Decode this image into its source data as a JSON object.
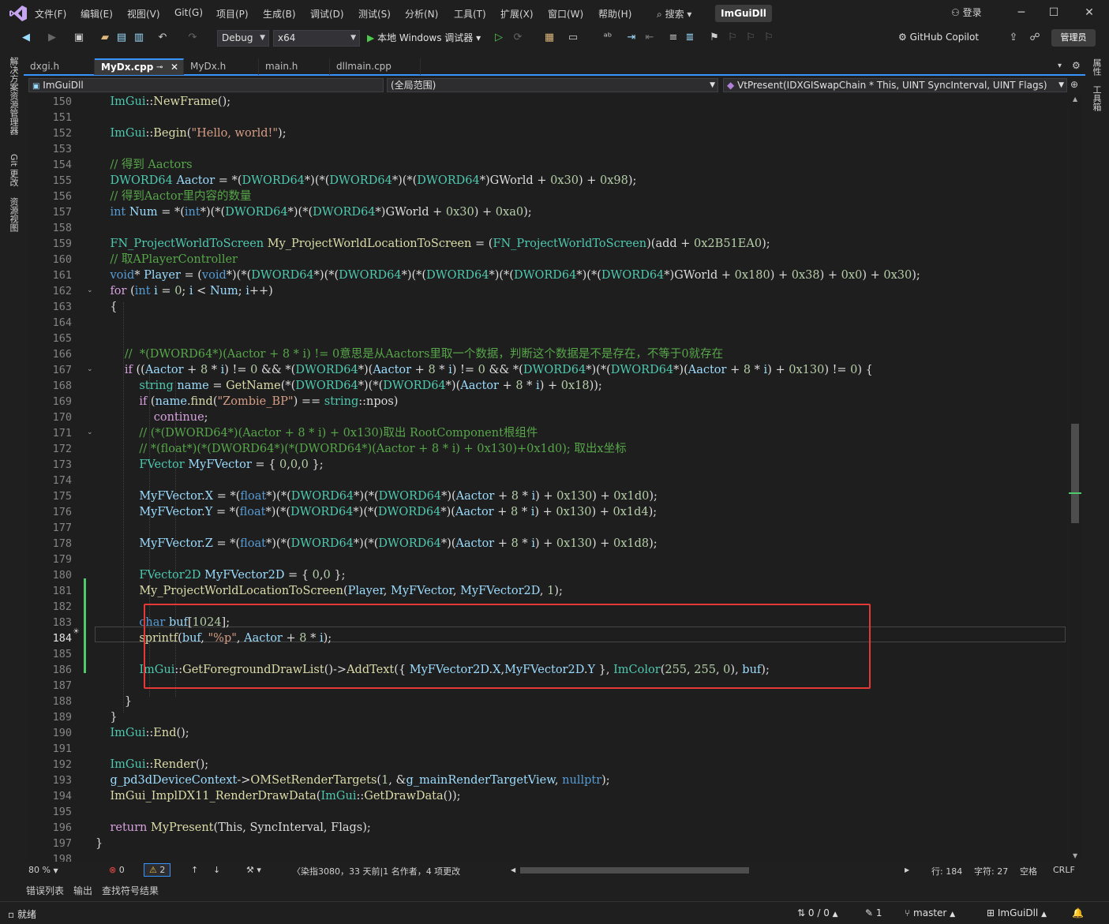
{
  "titlebar": {
    "menus": [
      "文件(F)",
      "编辑(E)",
      "视图(V)",
      "Git(G)",
      "项目(P)",
      "生成(B)",
      "调试(D)",
      "测试(S)",
      "分析(N)",
      "工具(T)",
      "扩展(X)",
      "窗口(W)",
      "帮助(H)"
    ],
    "search": "搜索",
    "solution": "ImGuiDll",
    "login": "登录"
  },
  "toolbar": {
    "config": "Debug",
    "platform": "x64",
    "debugger": "本地 Windows 调试器",
    "copilot": "GitHub Copilot",
    "admin": "管理员"
  },
  "left_panels": [
    "解决方案资源管理器",
    "Git 更改",
    "资源视图"
  ],
  "right_panels": [
    "属性",
    "工具箱"
  ],
  "tabs": [
    {
      "label": "dxgi.h"
    },
    {
      "label": "MyDx.cpp",
      "active": true
    },
    {
      "label": "MyDx.h"
    },
    {
      "label": "main.h"
    },
    {
      "label": "dllmain.cpp"
    }
  ],
  "navbar": {
    "project": "ImGuiDll",
    "scope": "(全局范围)",
    "member": "VtPresent(IDXGISwapChain * This, UINT SyncInterval, UINT Flags)"
  },
  "editor": {
    "first_line": 150,
    "current_line": 184,
    "line_numbers": [
      "150",
      "151",
      "152",
      "153",
      "154",
      "155",
      "156",
      "157",
      "158",
      "159",
      "160",
      "161",
      "162",
      "163",
      "164",
      "165",
      "166",
      "167",
      "168",
      "169",
      "170",
      "171",
      "172",
      "173",
      "174",
      "175",
      "176",
      "177",
      "178",
      "179",
      "180",
      "181",
      "182",
      "183",
      "184",
      "185",
      "186",
      "187",
      "188",
      "189",
      "190",
      "191",
      "192",
      "193",
      "194",
      "195",
      "196",
      "197",
      "198"
    ]
  },
  "edstatus": {
    "zoom": "80 %",
    "errors": "0",
    "warnings": "2",
    "codelens": "染指3080，33 天前|1 名作者，4 项更改",
    "line": "行: 184",
    "char": "字符: 27",
    "spaces": "空格",
    "eol": "CRLF"
  },
  "bottom_tabs": [
    "错误列表",
    "输出",
    "查找符号结果"
  ],
  "statusbar": {
    "ready": "就绪",
    "sync": "0 / 0",
    "pending": "1",
    "branch": "master",
    "repo": "ImGuiDll"
  },
  "colors": {
    "accent": "#3794ff",
    "highlight_box": "#e53935",
    "change_bar": "#4ec96b"
  }
}
